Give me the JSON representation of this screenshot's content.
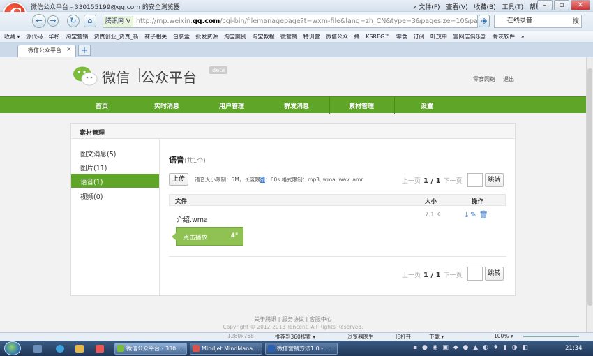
{
  "browser": {
    "window_title": "微信公众平台 - 330155199@qq.com 的安全浏览器",
    "menu_items": [
      "» 文件(F)",
      "查看(V)",
      "收藏(B)",
      "工具(T)",
      "帮助(H)"
    ],
    "addr_label": "腾讯网 V",
    "url_prefix": "http://mp.weixin.",
    "url_domain": "qq.com",
    "url_rest": "/cgi-bin/filemanagepage?t=wxm-file&lang=zh_CN&type=3&pagesize=10&pag",
    "search_value": "在线录音",
    "search_button": "搜",
    "favorites": [
      "收藏 ▾",
      "源代码",
      "华杉",
      "淘宝营销",
      "贾真创业_贾真_新",
      "袜子相关",
      "包装盒",
      "批发资源",
      "淘宝案例",
      "淘宝教程",
      "微营销",
      "特训营",
      "微信公众",
      "蜂",
      "KSREG™",
      "零食",
      "订阅",
      "叶茂中",
      "富网店俱乐部",
      "骨灰软件",
      "»"
    ],
    "tab_title": "微信公众平台",
    "tab_close": "×",
    "new_tab": "+"
  },
  "site": {
    "brand_cn": "微信",
    "brand_sub": "公众平台",
    "beta": "Beta",
    "user_name": "零食网络",
    "logout": "退出",
    "nav": [
      "首页",
      "实时消息",
      "用户管理",
      "群发消息",
      "素材管理",
      "设置"
    ]
  },
  "panel": {
    "title": "素材管理",
    "sidebar": [
      "图文消息(5)",
      "图片(11)",
      "语音(1)",
      "视频(0)"
    ],
    "active_index": 2,
    "section_title": "语音",
    "section_count": "(共1个)",
    "upload_label": "上传",
    "limits_prefix": "语音大小限制：5M，长度限",
    "limits_highlight": "制",
    "limits_suffix": "：60s 格式限制：mp3, wma, wav, amr",
    "pager_prev": "上一页",
    "pager_current": "1 / 1",
    "pager_next": "下一页",
    "pager_go": "跳转",
    "columns": [
      "文件",
      "大小",
      "操作"
    ],
    "files": [
      {
        "name": "介绍.wma",
        "size": "7.1 K",
        "play_label": "点击播放",
        "duration": "4\""
      }
    ]
  },
  "footer": {
    "links": "关于腾讯 | 服务协议 | 客服中心",
    "copyright": "Copyright © 2012-2013 Tencent. All Rights Reserved."
  },
  "statusbar": {
    "resolution": "1280x768",
    "promo": "推荐到360搜索 ▾",
    "doctor": "浏览器医生",
    "ie_open": "IE打开",
    "download": "下载 ▾",
    "zoom": "100% ▾"
  },
  "taskbar": {
    "tasks": [
      "微信公众平台 - 330...",
      "Mindjet MindMana...",
      "微信营销方法1.0 - ..."
    ],
    "clock": "21:34"
  }
}
